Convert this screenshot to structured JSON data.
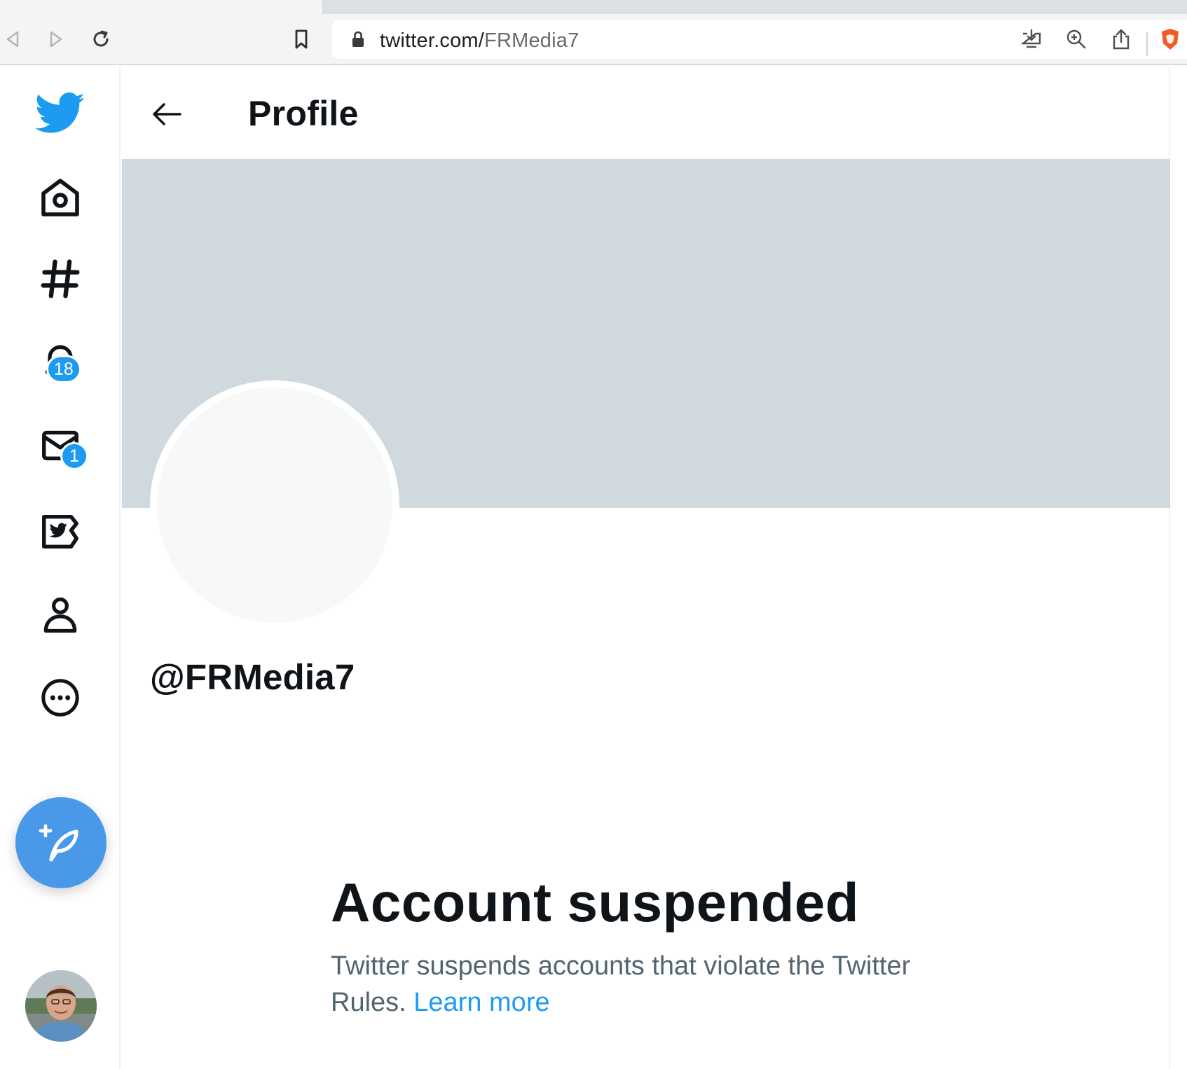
{
  "browser": {
    "url_host": "twitter.com/",
    "url_path": "FRMedia7",
    "icons": [
      "back-arrow-icon",
      "forward-arrow-icon",
      "reload-icon",
      "bookmark-icon",
      "lock-icon",
      "install-icon",
      "zoom-icon",
      "share-icon",
      "brave-shield-icon"
    ]
  },
  "nav": {
    "notifications_badge": "18",
    "messages_badge": "1",
    "items": [
      "home-icon",
      "explore-icon",
      "notifications-icon",
      "messages-icon",
      "twitter-blue-icon",
      "profile-icon",
      "more-icon"
    ]
  },
  "header": {
    "title": "Profile"
  },
  "profile": {
    "handle": "@FRMedia7"
  },
  "suspension": {
    "title": "Account suspended",
    "text": "Twitter suspends accounts that violate the Twitter Rules.",
    "link": "Learn more"
  },
  "colors": {
    "accent": "#1d9bf0",
    "compose": "#4a99e9",
    "banner": "#cfd9de",
    "secondary_text": "#536471"
  }
}
